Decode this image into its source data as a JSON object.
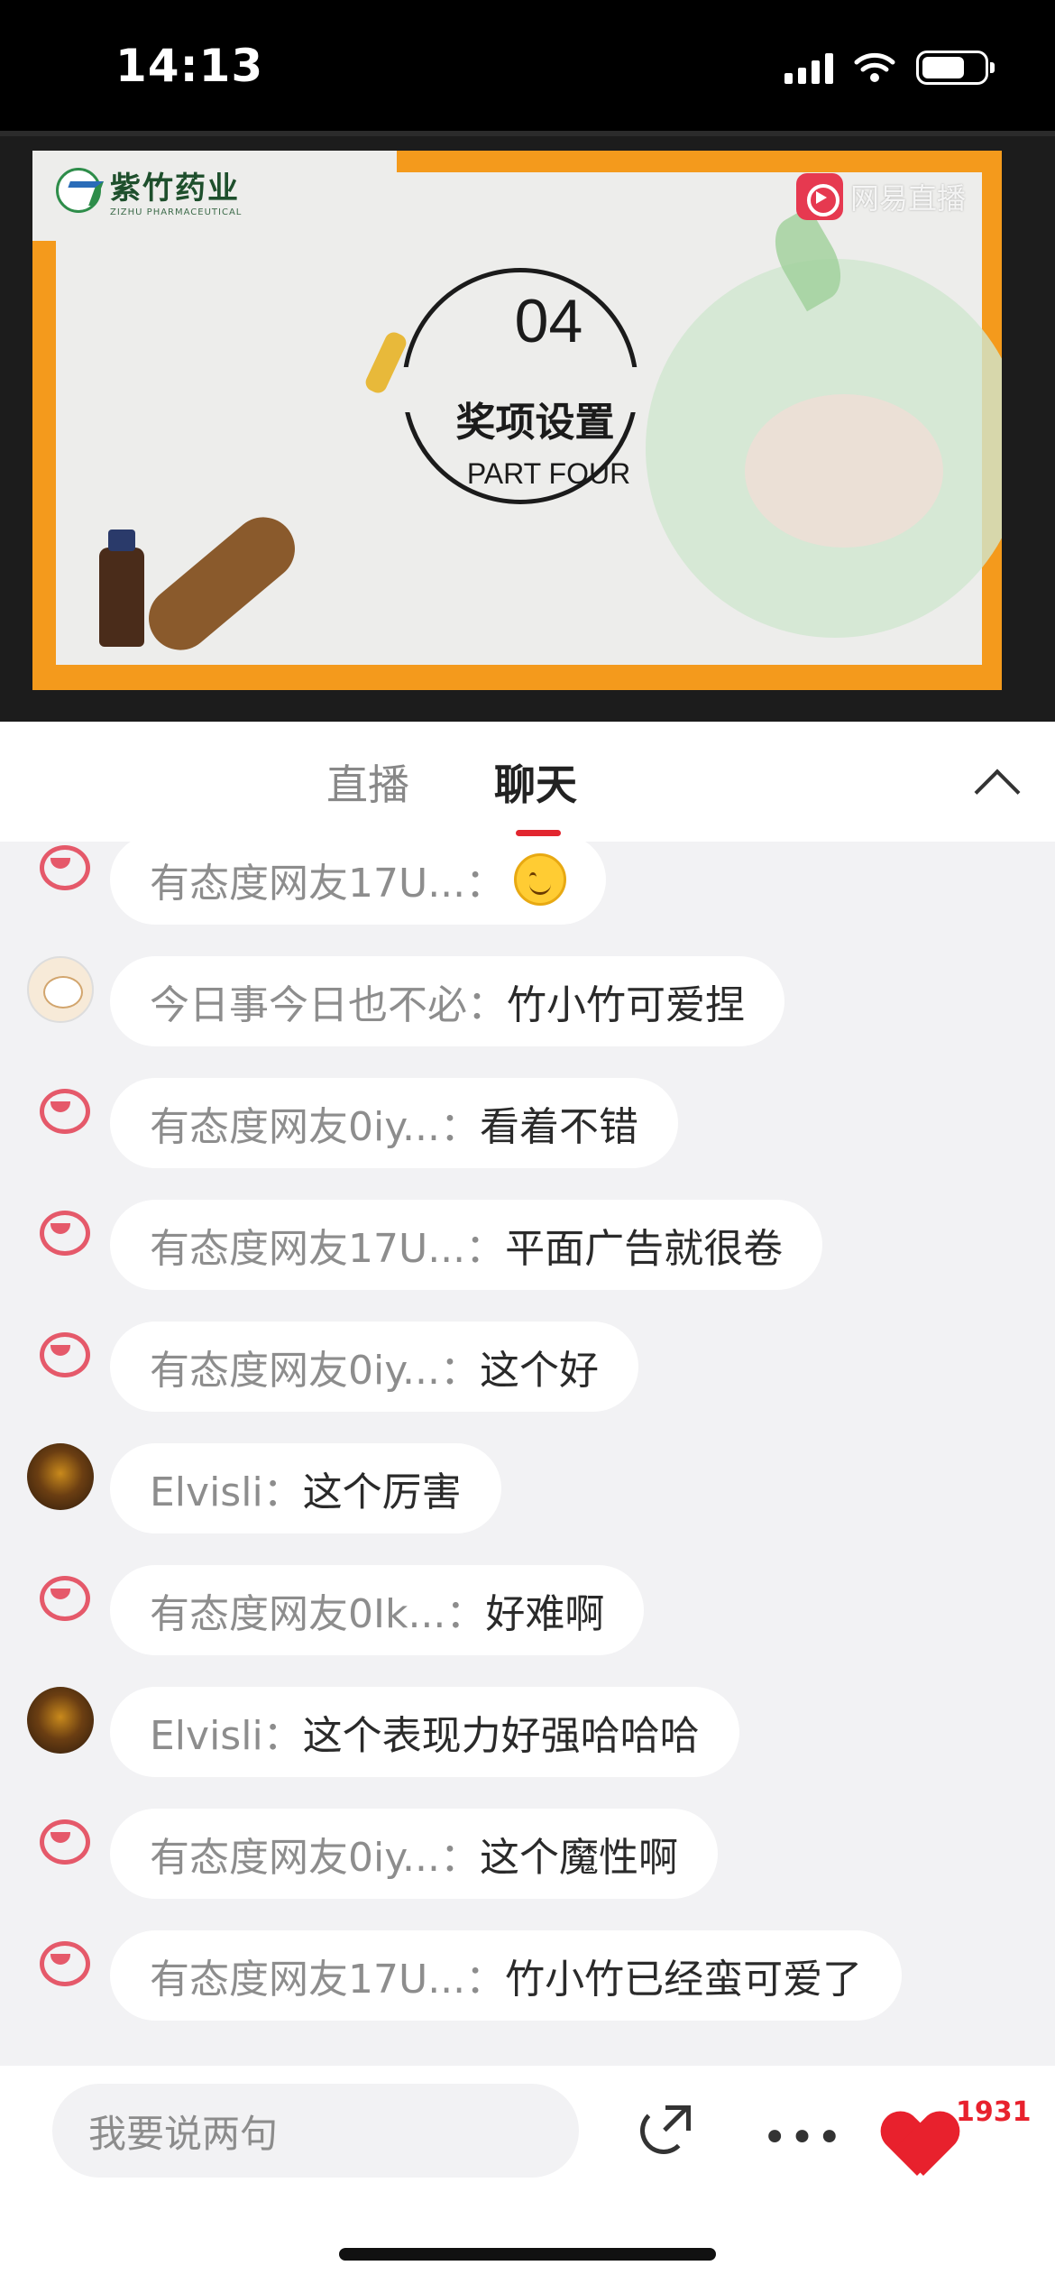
{
  "status_bar": {
    "time": "14:13"
  },
  "video": {
    "slide": {
      "brand_cn": "紫竹药业",
      "brand_en": "ZIZHU PHARMACEUTICAL",
      "part_number": "04",
      "title": "奖项设置",
      "subtitle": "PART FOUR"
    },
    "watermark": "网易直播"
  },
  "tabs": {
    "live_label": "直播",
    "chat_label": "聊天",
    "active": "聊天"
  },
  "chat": {
    "messages": [
      {
        "avatar": "bot",
        "nick": "有态度网友17U...：",
        "text": "",
        "emoji": "smiling-face"
      },
      {
        "avatar": "cat",
        "nick": "今日事今日也不必：",
        "text": "竹小竹可爱捏"
      },
      {
        "avatar": "bot",
        "nick": "有态度网友0iy...：",
        "text": "看着不错"
      },
      {
        "avatar": "bot",
        "nick": "有态度网友17U...：",
        "text": "平面广告就很卷"
      },
      {
        "avatar": "bot",
        "nick": "有态度网友0iy...：",
        "text": "这个好"
      },
      {
        "avatar": "dark",
        "nick": "Elvisli：",
        "text": "这个厉害"
      },
      {
        "avatar": "bot",
        "nick": "有态度网友0Ik...：",
        "text": "好难啊"
      },
      {
        "avatar": "dark",
        "nick": "Elvisli：",
        "text": "这个表现力好强哈哈哈"
      },
      {
        "avatar": "bot",
        "nick": "有态度网友0iy...：",
        "text": "这个魔性啊"
      },
      {
        "avatar": "bot",
        "nick": "有态度网友17U...：",
        "text": "竹小竹已经蛮可爱了"
      }
    ]
  },
  "bottom_bar": {
    "input_placeholder": "我要说两句",
    "like_count": "1931"
  },
  "colors": {
    "accent_red": "#e2262f",
    "slide_orange": "#f49a1c",
    "chat_background": "#f2f2f4"
  }
}
